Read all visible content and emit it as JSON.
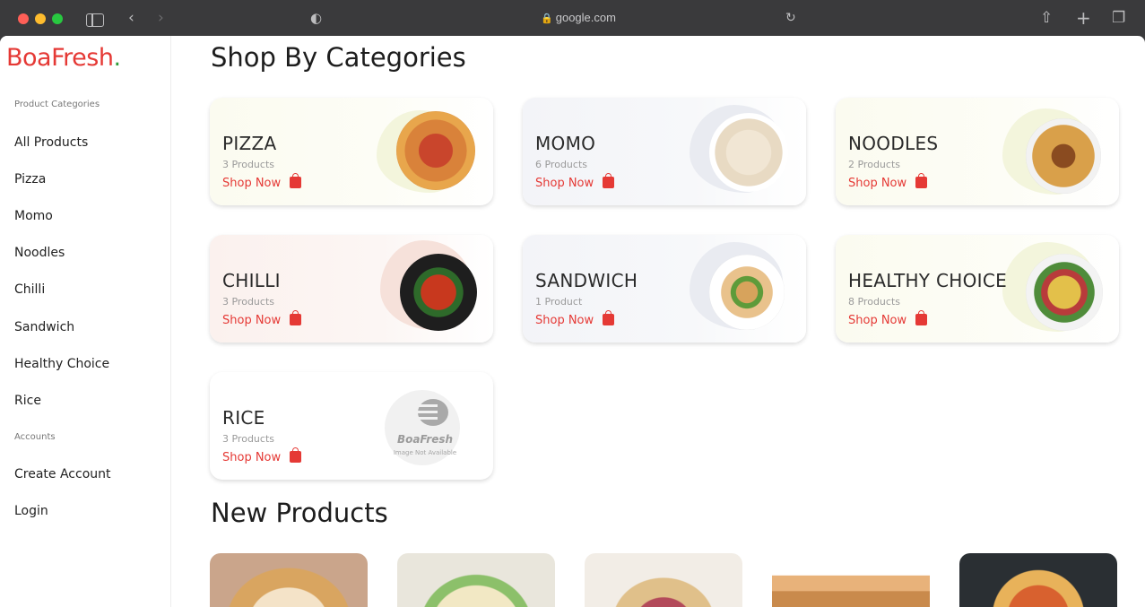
{
  "browser": {
    "address": "google.com",
    "lock_icon": "lock-icon"
  },
  "logo": {
    "part1": "Boa",
    "part2": "Fresh",
    "dot": "."
  },
  "sidebar": {
    "categories_heading": "Product Categories",
    "items": [
      "All Products",
      "Pizza",
      "Momo",
      "Noodles",
      "Chilli",
      "Sandwich",
      "Healthy Choice",
      "Rice"
    ],
    "accounts_heading": "Accounts",
    "account_items": [
      "Create Account",
      "Login"
    ]
  },
  "main": {
    "categories_title": "Shop By Categories",
    "new_products_title": "New Products",
    "shop_now": "Shop Now",
    "placeholder_brand": "BoaFresh",
    "placeholder_text": "Image Not Available",
    "categories": [
      {
        "name": "PIZZA",
        "count": "3 Products"
      },
      {
        "name": "MOMO",
        "count": "6 Products"
      },
      {
        "name": "NOODLES",
        "count": "2 Products"
      },
      {
        "name": "CHILLI",
        "count": "3 Products"
      },
      {
        "name": "SANDWICH",
        "count": "1 Product"
      },
      {
        "name": "HEALTHY CHOICE",
        "count": "8 Products"
      },
      {
        "name": "RICE",
        "count": "3 Products"
      }
    ]
  },
  "colors": {
    "accent_red": "#e53935",
    "logo_dot_green": "#2e9d3a"
  }
}
